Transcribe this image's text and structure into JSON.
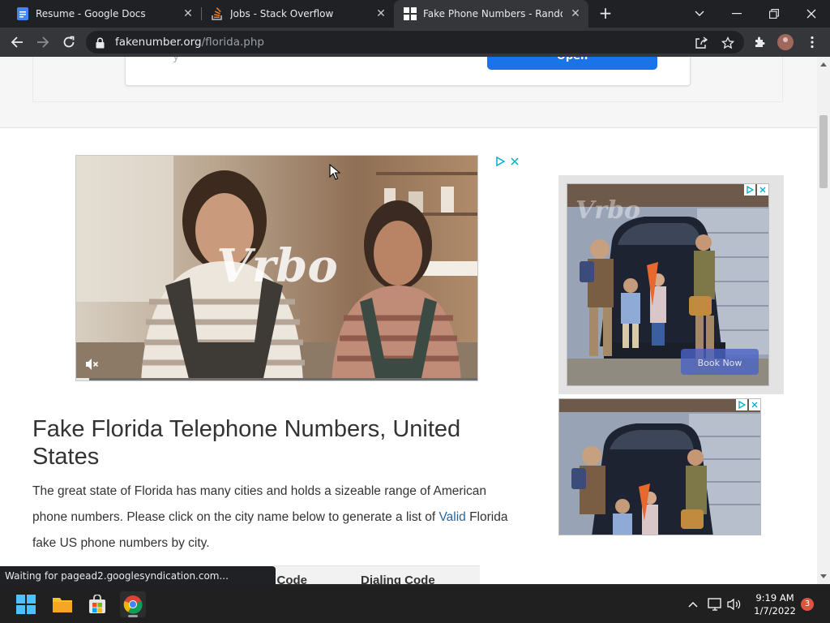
{
  "browser": {
    "tabs": [
      {
        "title": "Resume - Google Docs",
        "icon": "google-docs-icon",
        "active": false
      },
      {
        "title": "Jobs - Stack Overflow",
        "icon": "stack-overflow-icon",
        "active": false
      },
      {
        "title": "Fake Phone Numbers - Random",
        "icon": "fakenumber-icon",
        "active": true
      }
    ],
    "url_host": "fakenumber.org",
    "url_path": "/florida.php"
  },
  "ads": {
    "top_banner_faded": "y",
    "top_banner_button": "Open",
    "video_brand": "Vrbo",
    "side_brand": "Vrbo",
    "side_cta": "Book Now"
  },
  "page": {
    "title": "Fake Florida Telephone Numbers, United States",
    "intro_before_link": "The great state of Florida has many cities and holds a sizeable range of American phone numbers. Please click on the city name below to generate a list of ",
    "intro_link": "Valid",
    "intro_after_link": " Florida fake US phone numbers by city.",
    "table_headers": [
      "Area Code",
      "Dialing Code"
    ]
  },
  "status": "Waiting for pagead2.googlesyndication.com...",
  "taskbar": {
    "time": "9:19 AM",
    "date": "1/7/2022",
    "notifications": "3"
  },
  "colors": {
    "chrome_dark": "#202124",
    "chrome_toolbar": "#35363a",
    "link": "#2a6496",
    "button_blue": "#1a73e8",
    "notification_badge": "#e0533f"
  }
}
